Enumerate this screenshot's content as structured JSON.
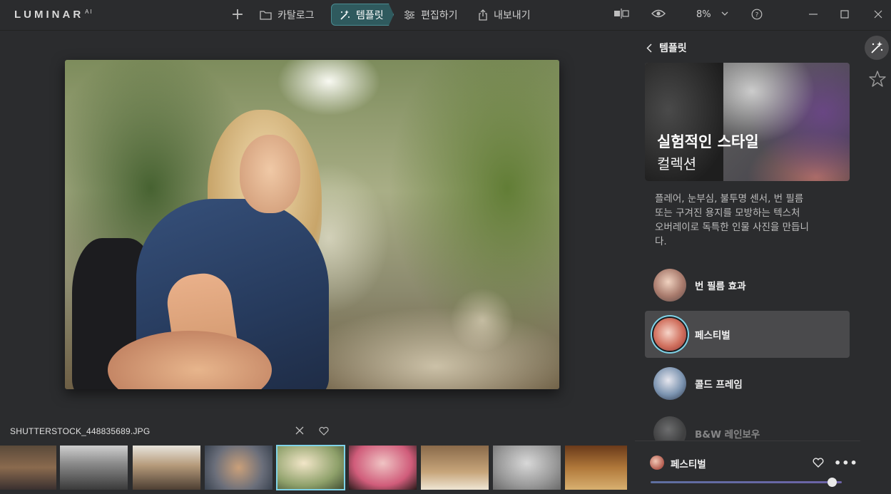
{
  "app": {
    "logo": "LUMINAR",
    "logo_sup": "AI"
  },
  "nav": {
    "add_label": "+",
    "catalog_label": "카탈로그",
    "templates_label": "템플릿",
    "edit_label": "편집하기",
    "export_label": "내보내기"
  },
  "toolbar": {
    "zoom_value": "8%"
  },
  "image": {
    "filename": "SHUTTERSTOCK_448835689.JPG"
  },
  "filmstrip": {
    "active_index": 4,
    "thumbs": [
      "library-students",
      "library-table",
      "students-group",
      "team-hands",
      "girl-river",
      "woman-pencil",
      "books-shelf",
      "open-book-ideas",
      "grand-library"
    ]
  },
  "panel": {
    "back_label": "템플릿",
    "hero_title": "실험적인 스타일",
    "hero_subtitle": "컬렉션",
    "description_lines": [
      "플레어, 눈부심, 불투명 센서, 번 필름",
      "또는 구겨진 용지를 모방하는 텍스처",
      "오버레이로 독특한 인물 사진을 만듭니",
      "다."
    ],
    "templates": [
      {
        "label": "번 필름 효과"
      },
      {
        "label": "페스티벌"
      },
      {
        "label": "콜드 프레임"
      },
      {
        "label": "B&W 레인보우"
      }
    ],
    "selected_template": "페스티벌",
    "amount": 0.95
  },
  "colors": {
    "accent": "#7fd3e8",
    "templates_active_bg": "#2f5a5e",
    "panel_bg": "#2b2c2e"
  }
}
